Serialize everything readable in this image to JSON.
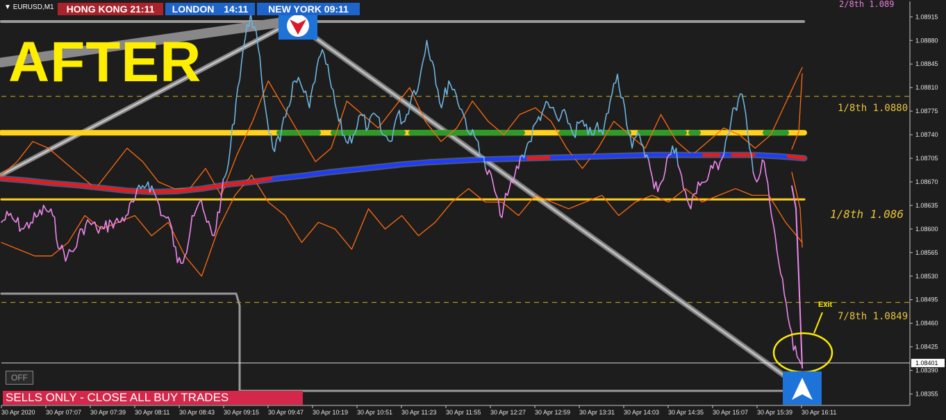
{
  "symbol": "EURUSD,M1",
  "clocks": [
    {
      "city": "HONG KONG",
      "time": "21:11",
      "color": "#a8232c"
    },
    {
      "city": "LONDON",
      "time": "14:11",
      "color": "#1f64c9"
    },
    {
      "city": "NEW YORK",
      "time": "09:11",
      "color": "#1f64c9"
    }
  ],
  "overlay_title": "AFTER",
  "off_button": "OFF",
  "banner": "SELLS ONLY - CLOSE ALL BUY TRADES",
  "exit_label": "Exit",
  "current_price": "1.08401",
  "murrey_labels": [
    {
      "text": "2/8th  1.089",
      "color": "#e880d8"
    },
    {
      "text": "1/8th  1.0880",
      "color": "#e8c43a"
    },
    {
      "text": "1/8th  1.086",
      "color": "#e8c43a"
    },
    {
      "text": "7/8th  1.0849",
      "color": "#e8c43a"
    }
  ],
  "colors": {
    "background": "#1d1d1d",
    "price_up": "#6fb4e0",
    "price_down": "#ee88ee",
    "envelope": "#ff6a10",
    "yellow": "#ffd21e",
    "green": "#2e9a2a",
    "blue": "#1e3bff",
    "red": "#e81a1a",
    "grey": "#9a9a9a"
  },
  "chart_data": {
    "type": "line",
    "ylim": [
      1.08338,
      1.08938
    ],
    "y_ticks": [
      "1.08915",
      "1.08880",
      "1.08845",
      "1.08810",
      "1.08775",
      "1.08740",
      "1.08705",
      "1.08670",
      "1.08635",
      "1.08600",
      "1.08565",
      "1.08530",
      "1.08495",
      "1.08460",
      "1.08425",
      "1.08390",
      "1.08355"
    ],
    "x_ticks": [
      "30 Apr 2020",
      "30 Apr 07:07",
      "30 Apr 07:39",
      "30 Apr 08:11",
      "30 Apr 08:43",
      "30 Apr 09:15",
      "30 Apr 09:47",
      "30 Apr 10:19",
      "30 Apr 10:51",
      "30 Apr 11:23",
      "30 Apr 11:55",
      "30 Apr 12:27",
      "30 Apr 12:59",
      "30 Apr 13:31",
      "30 Apr 14:03",
      "30 Apr 14:35",
      "30 Apr 15:07",
      "30 Apr 15:39",
      "30 Apr 16:11"
    ],
    "levels": {
      "upper_dashed": 1.08797,
      "yellow_upper": 1.08743,
      "yellow_lower": 1.08644,
      "lower_dashed": 1.08491,
      "current": 1.08401
    },
    "series": [
      {
        "values": [
          1.0861,
          1.0862,
          1.0861,
          1.086,
          1.0861,
          1.0862,
          1.0863,
          1.0862,
          1.0857,
          1.0856,
          1.0857,
          1.086,
          1.0861,
          1.086,
          1.086,
          1.0861,
          1.0861,
          1.0862,
          1.0864,
          1.0866,
          1.0867,
          1.0865,
          1.0862,
          1.0861,
          1.0855,
          1.0856,
          1.0862,
          1.0864,
          1.0861,
          1.0859,
          1.0865,
          1.087,
          1.0879,
          1.0887,
          1.0892,
          1.0887,
          1.0878,
          1.0872,
          1.0873,
          1.0878,
          1.0882,
          1.0881,
          1.0878,
          1.0884,
          1.0886,
          1.0881,
          1.0876,
          1.0873,
          1.0874,
          1.0877,
          1.0875,
          1.0877,
          1.0874,
          1.0873,
          1.0877,
          1.0876,
          1.088,
          1.0882,
          1.0888,
          1.0884,
          1.0878,
          1.0882,
          1.088,
          1.0877,
          1.0874,
          1.0873,
          1.0869,
          1.0867,
          1.0862,
          1.0865,
          1.0868,
          1.0871,
          1.0873,
          1.0876,
          1.0878,
          1.0878,
          1.0876,
          1.0877,
          1.0874,
          1.0876,
          1.0874,
          1.0875,
          1.0874,
          1.0879,
          1.0883,
          1.0878,
          1.0872,
          1.0874,
          1.0871,
          1.0866,
          1.0867,
          1.0871,
          1.0872,
          1.0866,
          1.0863,
          1.0867,
          1.0867,
          1.0869,
          1.087,
          1.0874,
          1.0878,
          1.088,
          1.0872,
          1.0867,
          1.087,
          1.0862,
          1.0855,
          1.0849,
          1.0842,
          1.084
        ]
      },
      {
        "values": [
          1.08675,
          1.08672,
          1.08668,
          1.08665,
          1.08661,
          1.08657,
          1.08655,
          1.08656,
          1.0866,
          1.08666,
          1.0867,
          1.08675,
          1.08679,
          1.08684,
          1.08688,
          1.08692,
          1.08696,
          1.08699,
          1.08701,
          1.08703,
          1.08704,
          1.08705,
          1.08706,
          1.08707,
          1.08708,
          1.08709,
          1.0871,
          1.0871,
          1.0871,
          1.0871,
          1.0871,
          1.08708,
          1.08705
        ]
      },
      {
        "values": [
          1.0868,
          1.087,
          1.0873,
          1.0872,
          1.087,
          1.0868,
          1.0866,
          1.0869,
          1.0872,
          1.087,
          1.0867,
          1.0866,
          1.0866,
          1.0869,
          1.0865,
          1.0871,
          1.0876,
          1.0882,
          1.0878,
          1.0874,
          1.087,
          1.0872,
          1.0879,
          1.0877,
          1.0875,
          1.0878,
          1.0881,
          1.0876,
          1.0873,
          1.0875,
          1.0879,
          1.0876,
          1.0874,
          1.0877,
          1.0878,
          1.0876,
          1.0872,
          1.0869,
          1.0872,
          1.0876,
          1.0874,
          1.0872,
          1.0877,
          1.0873,
          1.0871,
          1.0873,
          1.0875,
          1.0874,
          1.0872,
          1.0874,
          1.0879,
          1.0884
        ]
      },
      {
        "values": [
          1.0858,
          1.0857,
          1.0856,
          1.0856,
          1.0858,
          1.0862,
          1.086,
          1.0861,
          1.0862,
          1.0859,
          1.0861,
          1.0856,
          1.0853,
          1.086,
          1.0865,
          1.0868,
          1.0864,
          1.0862,
          1.0858,
          1.0861,
          1.086,
          1.0857,
          1.0863,
          1.086,
          1.0862,
          1.0859,
          1.0861,
          1.0864,
          1.0866,
          1.0864,
          1.0864,
          1.0862,
          1.0865,
          1.0864,
          1.0863,
          1.0864,
          1.0865,
          1.0862,
          1.0864,
          1.0865,
          1.0864,
          1.0866,
          1.0864,
          1.0865,
          1.0866,
          1.0865,
          1.0865,
          1.0861,
          1.0858
        ]
      }
    ]
  }
}
